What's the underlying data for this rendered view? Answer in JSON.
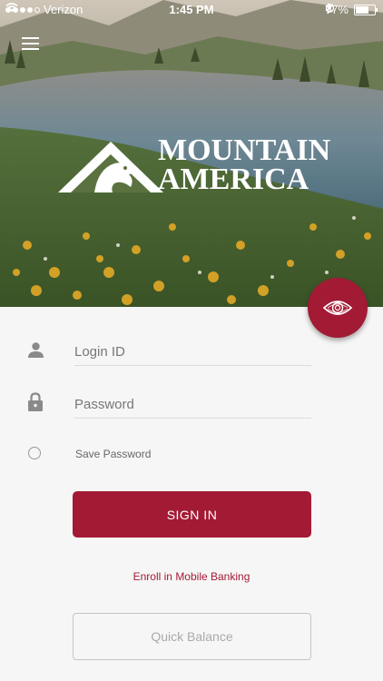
{
  "status_bar": {
    "carrier": "Verizon",
    "time": "1:45 PM",
    "battery": "77%",
    "battery_level": 0.77,
    "signal_bars_filled": 4,
    "signal_bars_total": 5
  },
  "header": {
    "menu_icon": "hamburger-menu-icon"
  },
  "brand": {
    "line1": "MOUNTAIN",
    "line2": "AMERICA",
    "logo_icon": "eagle-mountain-logo"
  },
  "biometric": {
    "icon": "eye-scan-icon",
    "color": "#a31a35"
  },
  "login": {
    "login_id_placeholder": "Login ID",
    "login_id_value": "",
    "password_placeholder": "Password",
    "password_value": "",
    "user_icon": "user-icon",
    "lock_icon": "lock-icon",
    "save_password_label": "Save Password",
    "save_password_checked": false,
    "sign_in_label": "SIGN IN",
    "enroll_label": "Enroll in Mobile Banking",
    "quick_balance_label": "Quick Balance"
  },
  "colors": {
    "accent": "#a31a35",
    "background": "#f6f6f6"
  }
}
